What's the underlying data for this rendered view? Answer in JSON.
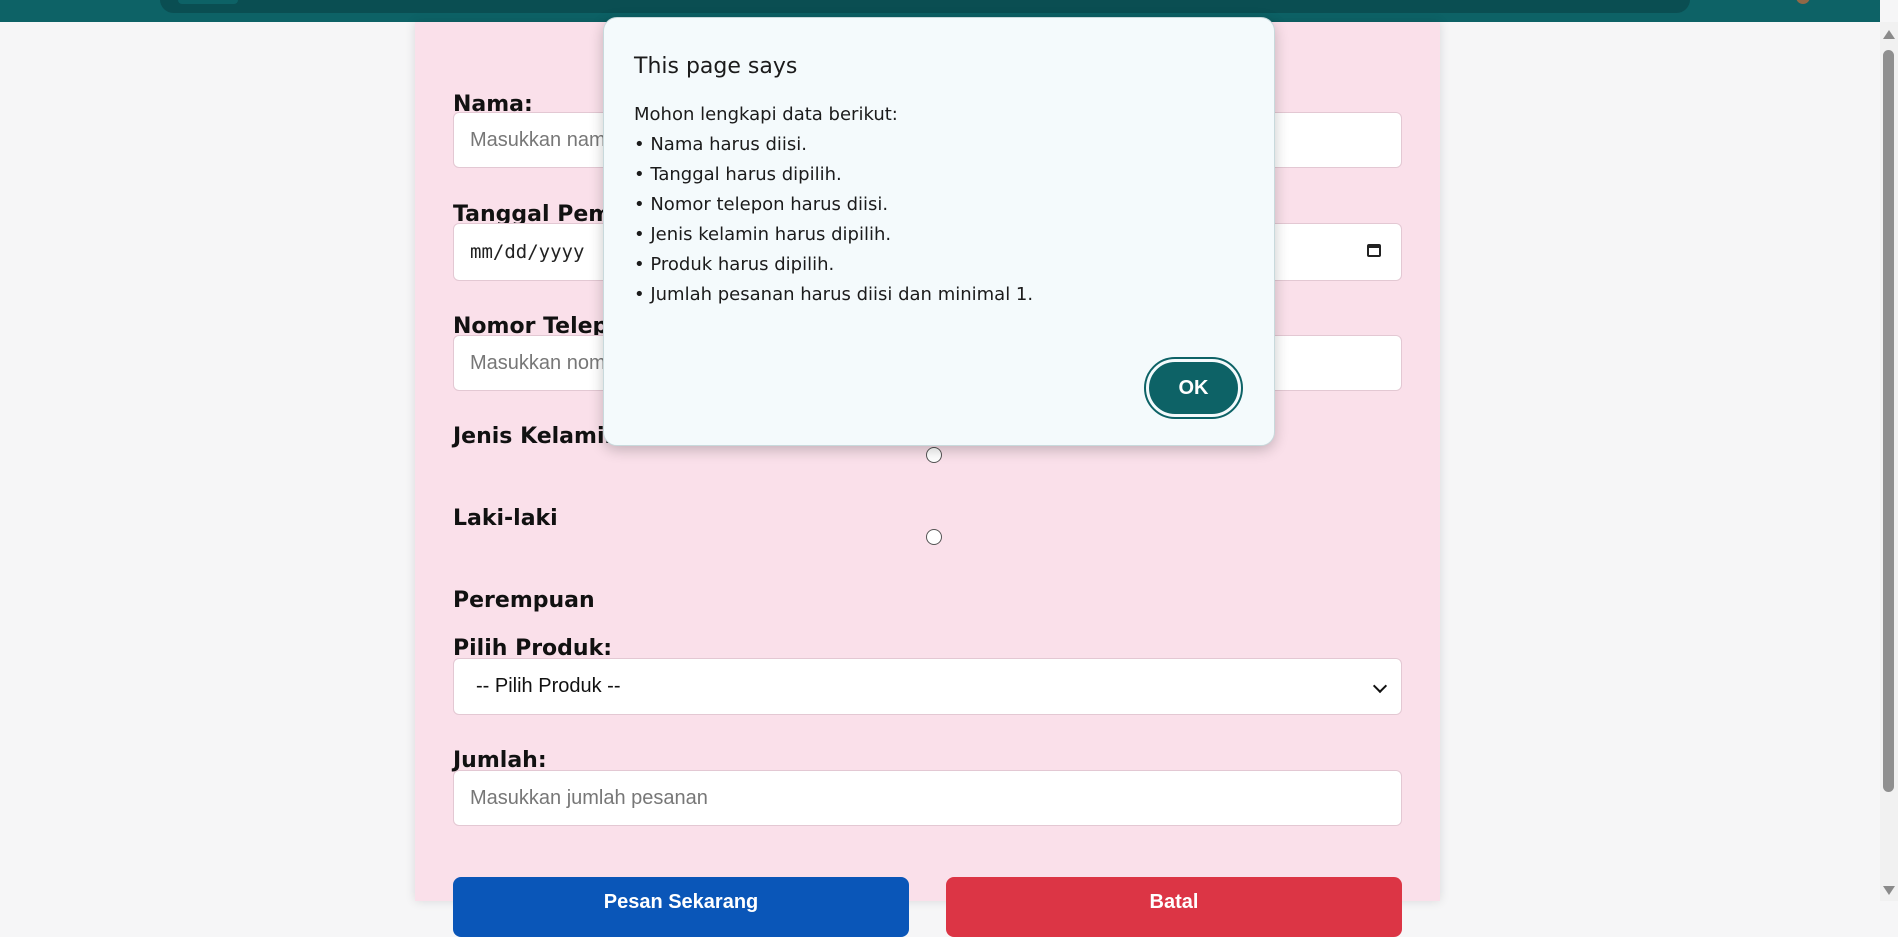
{
  "form": {
    "nama_label": "Nama:",
    "nama_placeholder": "Masukkan nama",
    "tanggal_label": "Tanggal Pemesanan:",
    "tanggal_value": "mm/dd/yyyy",
    "telepon_label": "Nomor Telepon:",
    "telepon_placeholder": "Masukkan nomor telepon",
    "gender_label": "Jenis Kelamin:",
    "gender_options": [
      "Laki-laki",
      "Perempuan"
    ],
    "produk_label": "Pilih Produk:",
    "produk_selected": "-- Pilih Produk --",
    "jumlah_label": "Jumlah:",
    "jumlah_placeholder": "Masukkan jumlah pesanan",
    "submit_label": "Pesan Sekarang",
    "cancel_label": "Batal"
  },
  "dialog": {
    "title": "This page says",
    "intro": "Mohon lengkapi data berikut:",
    "items": [
      "• Nama harus diisi.",
      "• Tanggal harus dipilih.",
      "• Nomor telepon harus diisi.",
      "• Jenis kelamin harus dipilih.",
      "• Produk harus dipilih.",
      "• Jumlah pesanan harus diisi dan minimal 1."
    ],
    "ok_label": "OK"
  },
  "colors": {
    "accent": "#0d6266",
    "card_background": "#fae0ea",
    "primary_button": "#0a56b8",
    "danger_button": "#dc3545"
  },
  "icons": [
    "calendar-icon",
    "chevron-down-icon"
  ]
}
